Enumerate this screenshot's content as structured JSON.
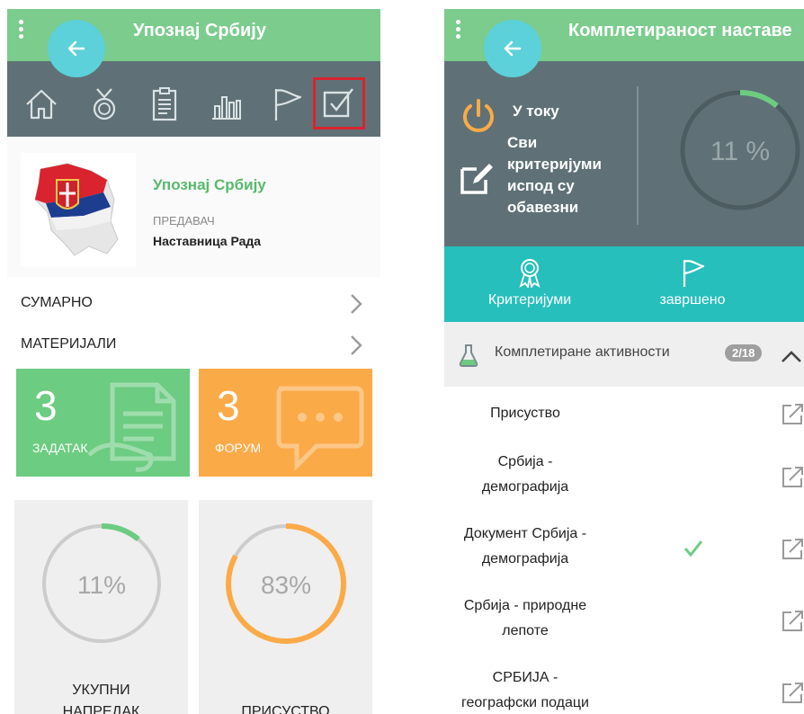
{
  "left": {
    "app_title": "Упознај Србију",
    "course": {
      "title": "Упознај Србију",
      "teacher_label": "ПРЕДАВАЧ",
      "teacher": "Наставница Рада"
    },
    "menu": [
      {
        "label": "СУМАРНО"
      },
      {
        "label": "МАТЕРИЈАЛИ"
      }
    ],
    "tiles": [
      {
        "count": "3",
        "label": "ЗАДАТАК",
        "color": "#6ccc81"
      },
      {
        "count": "3",
        "label": "ФОРУМ",
        "color": "#fbaa48"
      }
    ],
    "stats": [
      {
        "value": "11%",
        "line1": "УКУПНИ",
        "line2": "НАПРЕДАК",
        "percent": 11,
        "color": "#6ccc81"
      },
      {
        "value": "83%",
        "line1": "",
        "line2": "ПРИСУСТВО",
        "percent": 83,
        "color": "#fbaa48"
      }
    ],
    "toolbar_icons": [
      "home-icon",
      "medal-icon",
      "clipboard-icon",
      "bar-chart-icon",
      "flag-icon",
      "checkbox-icon"
    ]
  },
  "right": {
    "app_title": "Комплетираност наставе",
    "status": "У току",
    "criteria_note": "Сви\nкритеријуми\nиспод су\nобавезни",
    "progress": {
      "value": "11 %",
      "percent": 11
    },
    "tabs": [
      {
        "label": "Критеријуми"
      },
      {
        "label": "завршено"
      }
    ],
    "section": {
      "title": "Комплетиране активности",
      "badge": "2/18"
    },
    "activities": [
      {
        "name": "Присуство",
        "completed": false
      },
      {
        "name": "Србија -\nдемографија",
        "completed": false
      },
      {
        "name": "Документ Србија -\nдемографија",
        "completed": true
      },
      {
        "name": "Србија - природне\nлепоте",
        "completed": false
      },
      {
        "name": "СРБИЈА -\nгеографски подаци",
        "completed": false
      }
    ]
  },
  "colors": {
    "green": "#7bcc8d",
    "slate": "#5f7176",
    "teal": "#26bfbc",
    "orange": "#fbaa48",
    "accent_cyan": "#5cd1d9"
  }
}
